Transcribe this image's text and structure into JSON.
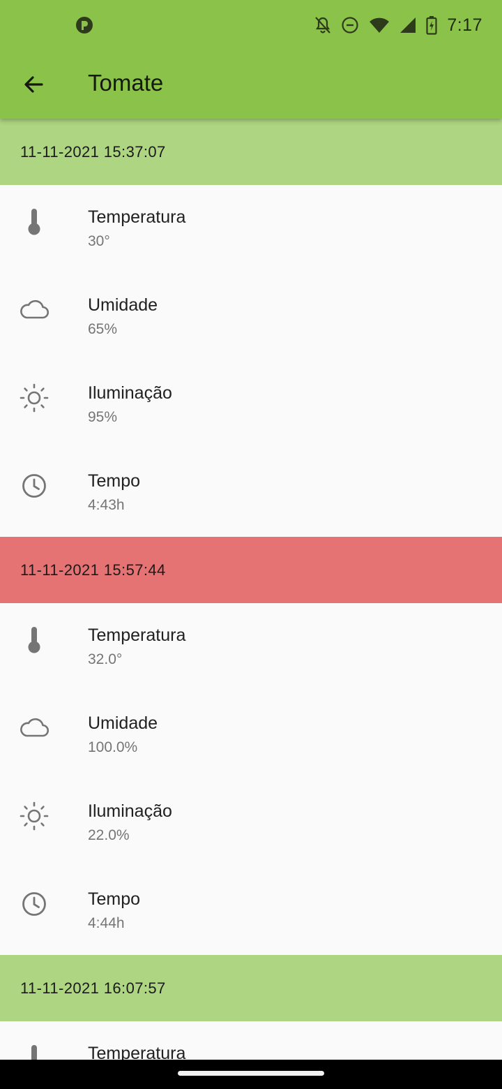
{
  "status_bar": {
    "time": "7:17",
    "icons": [
      "app-notification-icon",
      "notifications-off-icon",
      "do-not-disturb-icon",
      "wifi-icon",
      "cellular-signal-icon",
      "battery-charging-icon"
    ]
  },
  "toolbar": {
    "back_icon": "arrow-back-icon",
    "title": "Tomate"
  },
  "colors": {
    "app_bar": "#8bc34a",
    "header_ok": "#aed581",
    "header_alert": "#e57373",
    "background": "#fafafa"
  },
  "readings": [
    {
      "timestamp": "11-11-2021 15:37:07",
      "status": "ok",
      "items": [
        {
          "icon": "thermometer-icon",
          "label": "Temperatura",
          "value": "30°"
        },
        {
          "icon": "cloud-icon",
          "label": "Umidade",
          "value": "65%"
        },
        {
          "icon": "sun-icon",
          "label": "Iluminação",
          "value": "95%"
        },
        {
          "icon": "clock-icon",
          "label": "Tempo",
          "value": "4:43h"
        }
      ]
    },
    {
      "timestamp": "11-11-2021 15:57:44",
      "status": "alert",
      "items": [
        {
          "icon": "thermometer-icon",
          "label": "Temperatura",
          "value": "32.0°"
        },
        {
          "icon": "cloud-icon",
          "label": "Umidade",
          "value": "100.0%"
        },
        {
          "icon": "sun-icon",
          "label": "Iluminação",
          "value": "22.0%"
        },
        {
          "icon": "clock-icon",
          "label": "Tempo",
          "value": "4:44h"
        }
      ]
    },
    {
      "timestamp": "11-11-2021 16:07:57",
      "status": "ok",
      "items": [
        {
          "icon": "thermometer-icon",
          "label": "Temperatura",
          "value": ""
        }
      ]
    }
  ]
}
